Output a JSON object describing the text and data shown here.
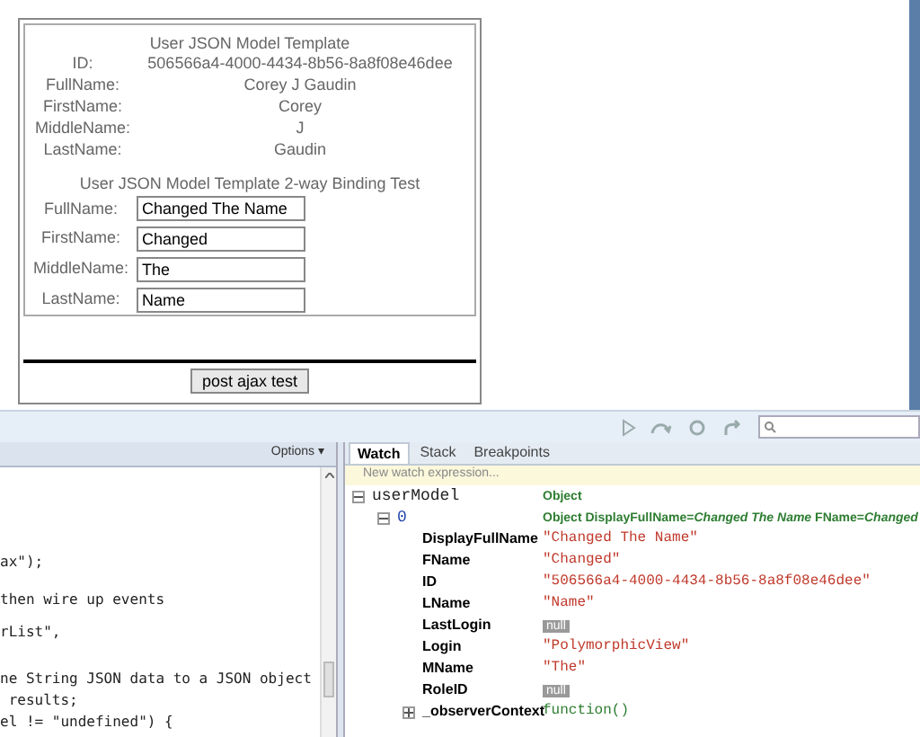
{
  "template": {
    "title": "User JSON Model Template",
    "fields": [
      {
        "label": "ID:",
        "value": "506566a4-4000-4434-8b56-8a8f08e46dee"
      },
      {
        "label": "FullName:",
        "value": "Corey J Gaudin"
      },
      {
        "label": "FirstName:",
        "value": "Corey"
      },
      {
        "label": "MiddleName:",
        "value": "J"
      },
      {
        "label": "LastName:",
        "value": "Gaudin"
      }
    ]
  },
  "binding": {
    "title": "User JSON Model Template 2-way Binding Test",
    "inputs": [
      {
        "label": "FullName:",
        "value": "Changed The Name"
      },
      {
        "label": "FirstName:",
        "value": "Changed"
      },
      {
        "label": "MiddleName:",
        "value": "The"
      },
      {
        "label": "LastName:",
        "value": "Name"
      }
    ]
  },
  "post_button": "post ajax test",
  "code_pane": {
    "options": "Options ▾",
    "lines": [
      "ax\");",
      "then wire up events",
      "rList\",",
      "ne String JSON data to a JSON object",
      " results;",
      "el != \"undefined\") {"
    ]
  },
  "watch": {
    "tabs": [
      {
        "label": "Watch",
        "selected": true
      },
      {
        "label": "Stack",
        "selected": false
      },
      {
        "label": "Breakpoints",
        "selected": false
      }
    ],
    "new_expression": "New watch expression...",
    "tree": [
      {
        "name": "userModel",
        "value": "Object",
        "kind": "object",
        "expanded": true,
        "children": [
          {
            "name": "0",
            "value": "**Object DisplayFullName**=*Changed The Name* **FName**=*Changed*",
            "kind": "object",
            "expanded": true,
            "children": [
              {
                "name": "DisplayFullName",
                "value": "\"Changed The Name\"",
                "kind": "string"
              },
              {
                "name": "FName",
                "value": "\"Changed\"",
                "kind": "string"
              },
              {
                "name": "ID",
                "value": "\"506566a4-4000-4434-8b56-8a8f08e46dee\"",
                "kind": "string"
              },
              {
                "name": "LName",
                "value": "\"Name\"",
                "kind": "string"
              },
              {
                "name": "LastLogin",
                "value": "null",
                "kind": "null"
              },
              {
                "name": "Login",
                "value": "\"PolymorphicView\"",
                "kind": "string"
              },
              {
                "name": "MName",
                "value": "\"The\"",
                "kind": "string"
              },
              {
                "name": "RoleID",
                "value": "null",
                "kind": "null"
              },
              {
                "name": "_observerContext",
                "value": "function()",
                "kind": "function",
                "expanded": false
              }
            ]
          }
        ]
      }
    ]
  }
}
